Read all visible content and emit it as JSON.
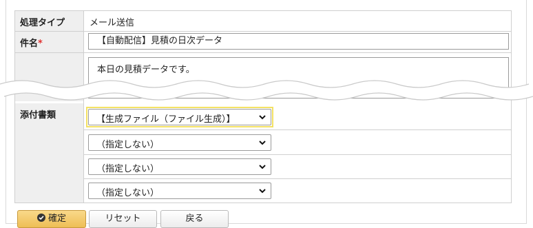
{
  "form": {
    "process_type": {
      "label": "処理タイプ",
      "value": "メール送信"
    },
    "subject": {
      "label": "件名",
      "required_mark": "*",
      "value": "【自動配信】見積の日次データ"
    },
    "body": {
      "value": "本日の見積データです。"
    },
    "attachments": {
      "label": "添付書類",
      "selects": [
        {
          "value": "【生成ファイル（ファイル生成）】"
        },
        {
          "value": "（指定しない）"
        },
        {
          "value": "（指定しない）"
        },
        {
          "value": "（指定しない）"
        }
      ]
    }
  },
  "buttons": {
    "confirm": "確定",
    "reset": "リセット",
    "back": "戻る"
  },
  "colors": {
    "highlight": "#f3e163",
    "required": "#e0312f",
    "primary_button": "#eebe55"
  }
}
